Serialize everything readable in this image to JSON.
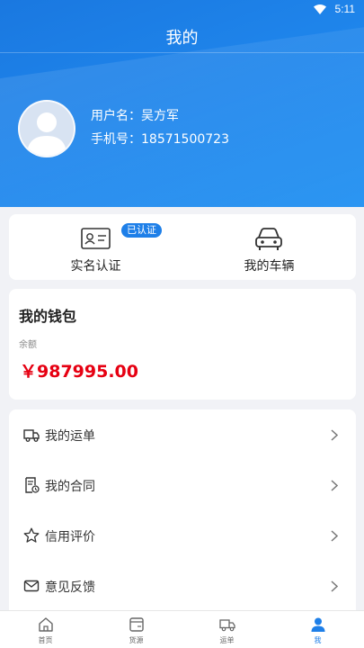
{
  "status_bar": {
    "time": "5:11"
  },
  "header": {
    "title": "我的"
  },
  "user": {
    "name_label": "用户名：",
    "name": "吴方军",
    "phone_label": "手机号：",
    "phone": "18571500723"
  },
  "auth": {
    "real_name": {
      "label": "实名认证",
      "badge": "已认证"
    },
    "vehicle": {
      "label": "我的车辆"
    }
  },
  "wallet": {
    "title": "我的钱包",
    "balance_label": "余额",
    "balance": "￥987995.00"
  },
  "menu": [
    {
      "label": "我的运单",
      "icon": "truck-icon"
    },
    {
      "label": "我的合同",
      "icon": "contract-icon"
    },
    {
      "label": "信用评价",
      "icon": "star-icon"
    },
    {
      "label": "意见反馈",
      "icon": "mail-icon"
    }
  ],
  "tabs": [
    {
      "label": "首页",
      "icon": "home-icon"
    },
    {
      "label": "货源",
      "icon": "cargo-icon"
    },
    {
      "label": "运单",
      "icon": "truck-icon"
    },
    {
      "label": "我",
      "icon": "user-icon",
      "active": true
    }
  ],
  "colors": {
    "primary": "#1e7fe8",
    "balance": "#e60012"
  }
}
